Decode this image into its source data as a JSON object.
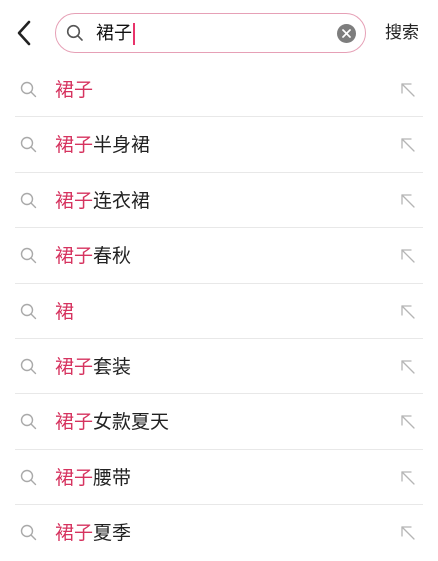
{
  "colors": {
    "accent": "#d6335f",
    "border": "#e6a0b6",
    "divider": "#e8e8e8",
    "icon": "#a9a9a9"
  },
  "header": {
    "back_icon": "chevron-left-icon",
    "search": {
      "value": "裙子",
      "search_icon": "search-icon",
      "clear_icon": "clear-icon"
    },
    "search_button_label": "搜索"
  },
  "suggestions": [
    {
      "highlight": "裙子",
      "rest": ""
    },
    {
      "highlight": "裙子",
      "rest": "半身裙"
    },
    {
      "highlight": "裙子",
      "rest": "连衣裙"
    },
    {
      "highlight": "裙子",
      "rest": "春秋"
    },
    {
      "highlight": "裙",
      "rest": ""
    },
    {
      "highlight": "裙子",
      "rest": "套装"
    },
    {
      "highlight": "裙子",
      "rest": "女款夏天"
    },
    {
      "highlight": "裙子",
      "rest": "腰带"
    },
    {
      "highlight": "裙子",
      "rest": "夏季"
    }
  ]
}
